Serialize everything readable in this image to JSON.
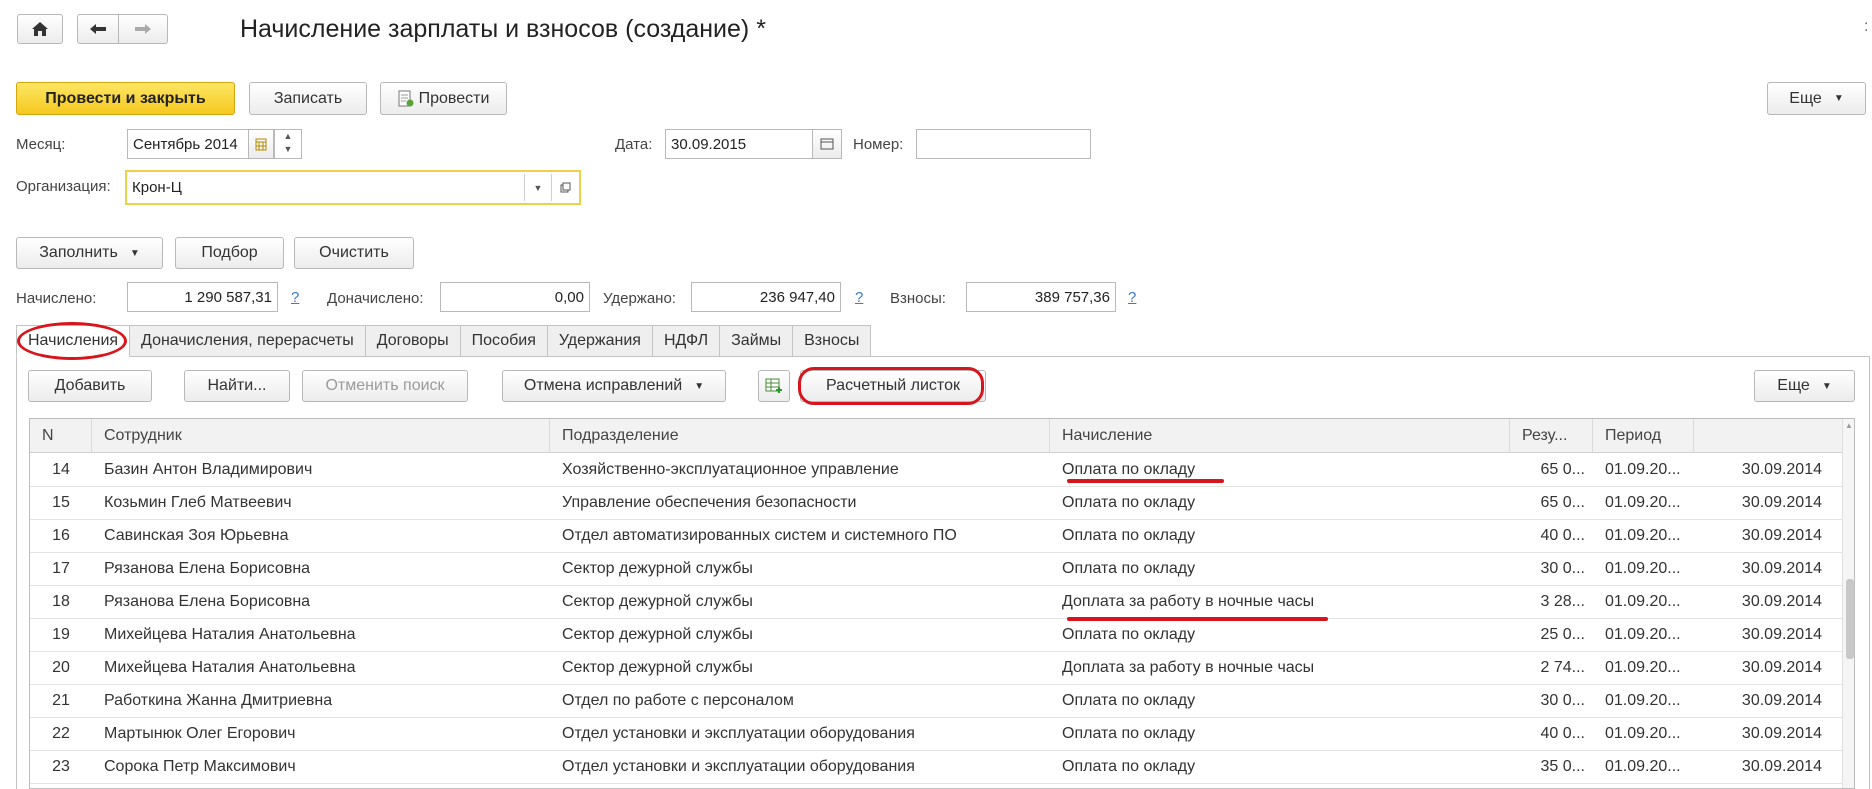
{
  "title": "Начисление зарплаты и взносов (создание) *",
  "toolbar": {
    "post_close": "Провести и закрыть",
    "save": "Записать",
    "post": "Провести",
    "more": "Еще"
  },
  "form": {
    "month_label": "Месяц:",
    "month_value": "Сентябрь 2014",
    "date_label": "Дата:",
    "date_value": "30.09.2015",
    "number_label": "Номер:",
    "number_value": "",
    "org_label": "Организация:",
    "org_value": "Крон-Ц"
  },
  "actions": {
    "fill": "Заполнить",
    "pick": "Подбор",
    "clear": "Очистить"
  },
  "totals": {
    "accrued_label": "Начислено:",
    "accrued_value": "1 290 587,31",
    "extra_label": "Доначислено:",
    "extra_value": "0,00",
    "withheld_label": "Удержано:",
    "withheld_value": "236 947,40",
    "contrib_label": "Взносы:",
    "contrib_value": "389 757,36",
    "help": "?"
  },
  "tabs": [
    "Начисления",
    "Доначисления, перерасчеты",
    "Договоры",
    "Пособия",
    "Удержания",
    "НДФЛ",
    "Займы",
    "Взносы"
  ],
  "tab_toolbar": {
    "add": "Добавить",
    "find": "Найти...",
    "cancel_search": "Отменить поиск",
    "cancel_fix": "Отмена исправлений",
    "payslip": "Расчетный листок",
    "more": "Еще"
  },
  "table": {
    "columns": [
      "N",
      "Сотрудник",
      "Подразделение",
      "Начисление",
      "Резу...",
      "Период",
      ""
    ],
    "rows": [
      [
        "14",
        "Базин Антон Владимирович",
        "Хозяйственно-эксплуатационное управление",
        "Оплата по окладу",
        "65 0...",
        "01.09.20...",
        "30.09.2014"
      ],
      [
        "15",
        "Козьмин Глеб Матвеевич",
        "Управление обеспечения безопасности",
        "Оплата по окладу",
        "65 0...",
        "01.09.20...",
        "30.09.2014"
      ],
      [
        "16",
        "Савинская Зоя Юрьевна",
        "Отдел автоматизированных систем и системного ПО",
        "Оплата по окладу",
        "40 0...",
        "01.09.20...",
        "30.09.2014"
      ],
      [
        "17",
        "Рязанова Елена Борисовна",
        "Сектор дежурной службы",
        "Оплата по окладу",
        "30 0...",
        "01.09.20...",
        "30.09.2014"
      ],
      [
        "18",
        "Рязанова Елена Борисовна",
        "Сектор дежурной службы",
        "Доплата за работу в ночные часы",
        "3 28...",
        "01.09.20...",
        "30.09.2014"
      ],
      [
        "19",
        "Михейцева Наталия Анатольевна",
        "Сектор дежурной службы",
        "Оплата по окладу",
        "25 0...",
        "01.09.20...",
        "30.09.2014"
      ],
      [
        "20",
        "Михейцева Наталия Анатольевна",
        "Сектор дежурной службы",
        "Доплата за работу в ночные часы",
        "2 74...",
        "01.09.20...",
        "30.09.2014"
      ],
      [
        "21",
        "Работкина Жанна Дмитриевна",
        "Отдел по работе с персоналом",
        "Оплата по окладу",
        "30 0...",
        "01.09.20...",
        "30.09.2014"
      ],
      [
        "22",
        "Мартынюк Олег Егорович",
        "Отдел установки и эксплуатации оборудования",
        "Оплата по окладу",
        "40 0...",
        "01.09.20...",
        "30.09.2014"
      ],
      [
        "23",
        "Сорока Петр Максимович",
        "Отдел установки и эксплуатации оборудования",
        "Оплата по окладу",
        "35 0...",
        "01.09.20...",
        "30.09.2014"
      ]
    ]
  },
  "colors": {
    "accent_yellow": "#f5c81e",
    "annotation_red": "#d8141c",
    "link_blue": "#3b7bc8"
  }
}
